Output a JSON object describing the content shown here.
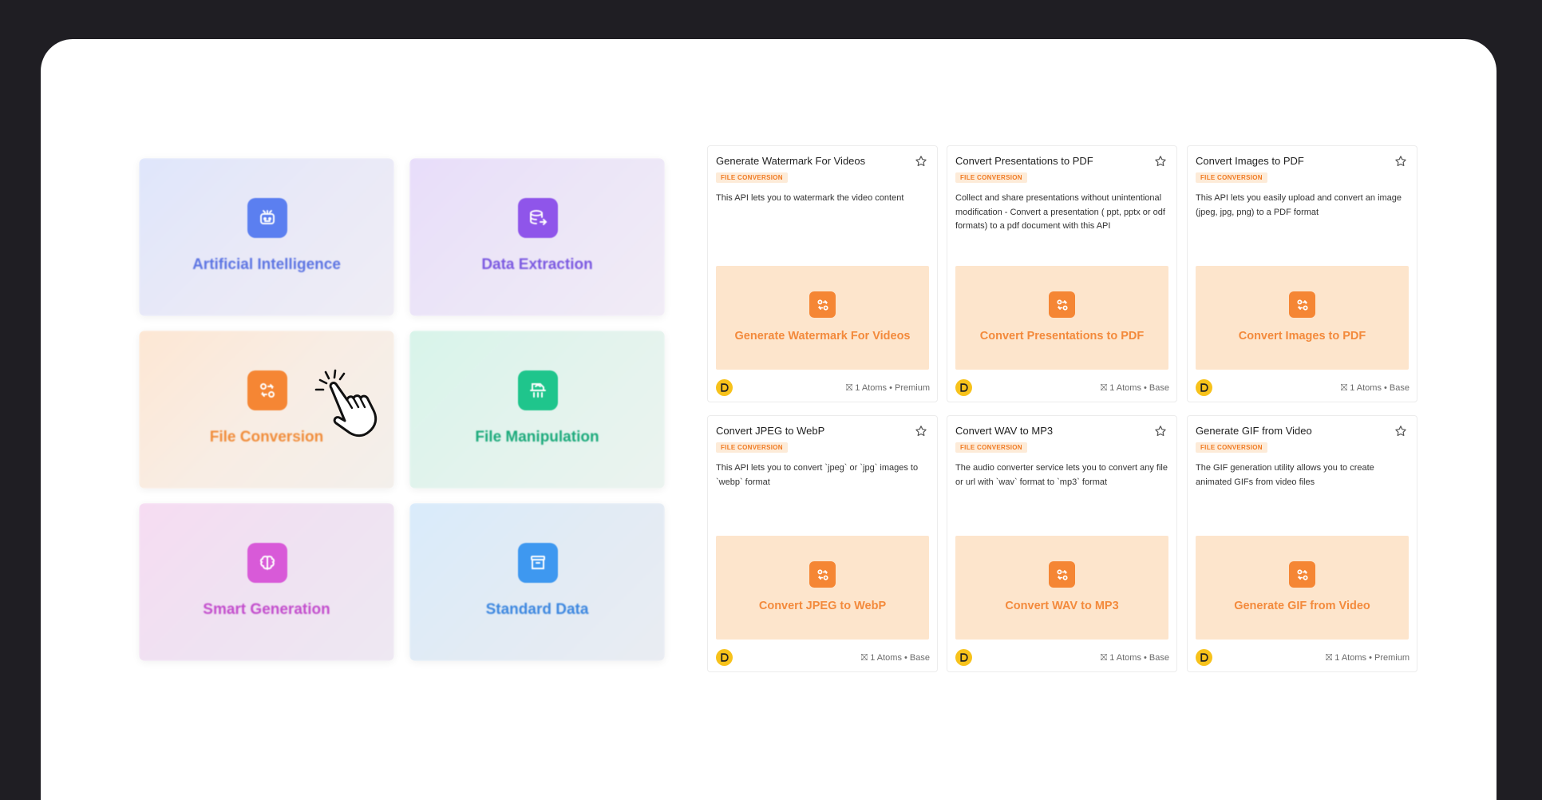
{
  "categories": [
    {
      "label": "Artificial Intelligence",
      "icon": "robot-icon",
      "color": "#5b7ff0",
      "label_color": "#5c74e2"
    },
    {
      "label": "Data Extraction",
      "icon": "database-export-icon",
      "color": "#8f55ea",
      "label_color": "#7a58e0"
    },
    {
      "label": "File Conversion",
      "icon": "file-conversion-icon",
      "color": "#f58634",
      "label_color": "#f08c3a"
    },
    {
      "label": "File Manipulation",
      "icon": "file-edit-icon",
      "color": "#1fc58c",
      "label_color": "#1aa97a"
    },
    {
      "label": "Smart Generation",
      "icon": "brain-icon",
      "color": "#d85ad8",
      "label_color": "#c24ccc"
    },
    {
      "label": "Standard Data",
      "icon": "archive-icon",
      "color": "#3e98f0",
      "label_color": "#3b86df"
    }
  ],
  "apis": [
    {
      "title": "Generate Watermark For Videos",
      "tag": "FILE CONVERSION",
      "description": "This API lets you to watermark the video content",
      "thumb_label": "Generate Watermark For Videos",
      "meta": "1 Atoms • Premium"
    },
    {
      "title": "Convert Presentations to PDF",
      "tag": "FILE CONVERSION",
      "description": "Collect and share presentations without unintentional modification - Convert a presentation ( ppt, pptx or odf formats) to a pdf document with this API",
      "thumb_label": "Convert Presentations to PDF",
      "meta": "1 Atoms • Base"
    },
    {
      "title": "Convert Images to PDF",
      "tag": "FILE CONVERSION",
      "description": "This API lets you easily upload and convert an image (jpeg, jpg, png) to a PDF format",
      "thumb_label": "Convert Images to PDF",
      "meta": "1 Atoms • Base"
    },
    {
      "title": "Convert JPEG to WebP",
      "tag": "FILE CONVERSION",
      "description": "This API lets you to convert `jpeg` or `jpg` images to `webp` format",
      "thumb_label": "Convert JPEG to WebP",
      "meta": "1 Atoms • Base"
    },
    {
      "title": "Convert WAV to MP3",
      "tag": "FILE CONVERSION",
      "description": "The audio converter service lets you to convert any file or url with `wav` format to `mp3` format",
      "thumb_label": "Convert WAV to MP3",
      "meta": "1 Atoms • Base"
    },
    {
      "title": "Generate GIF from Video",
      "tag": "FILE CONVERSION",
      "description": "The GIF generation utility allows you to create animated GIFs from video files",
      "thumb_label": "Generate GIF from Video",
      "meta": "1 Atoms • Premium"
    }
  ],
  "colors": {
    "accent_orange": "#f58634",
    "tag_bg": "#fdebd8",
    "thumb_bg": "#fde5cc",
    "avatar": "#f7c21b"
  }
}
